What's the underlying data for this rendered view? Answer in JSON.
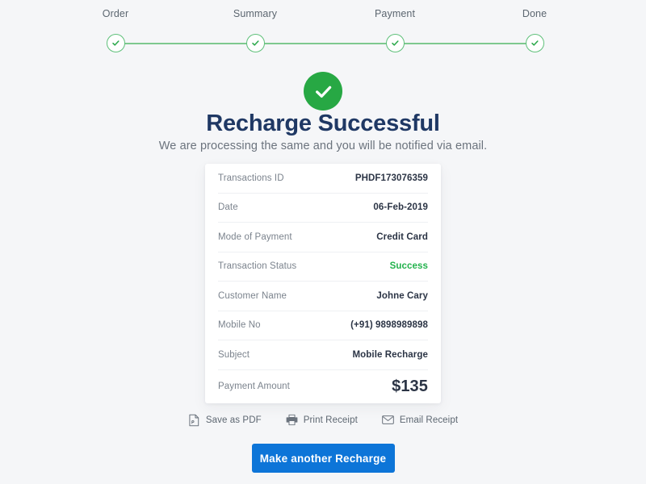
{
  "stepper": {
    "steps": [
      {
        "label": "Order",
        "state": "complete",
        "icon": "check-icon"
      },
      {
        "label": "Summary",
        "state": "complete",
        "icon": "check-icon"
      },
      {
        "label": "Payment",
        "state": "complete",
        "icon": "check-icon"
      },
      {
        "label": "Done",
        "state": "complete",
        "icon": "check-icon"
      }
    ],
    "line_color": "#7ec98f",
    "dot_border_color": "#5fc07a",
    "check_color": "#2aa84a"
  },
  "status": {
    "icon": "check-circle-icon",
    "icon_color": "#27a844",
    "headline": "Recharge Successful",
    "subhead": "We are processing the same and you will be notified via email."
  },
  "receipt": {
    "rows": [
      {
        "label": "Transactions ID",
        "value": "PHDF173076359"
      },
      {
        "label": "Date",
        "value": "06-Feb-2019"
      },
      {
        "label": "Mode of Payment",
        "value": "Credit Card"
      },
      {
        "label": "Transaction Status",
        "value": "Success"
      },
      {
        "label": "Customer Name",
        "value": "Johne Cary"
      },
      {
        "label": "Mobile No",
        "value": "(+91) 9898989898"
      },
      {
        "label": "Subject",
        "value": "Mobile Recharge"
      },
      {
        "label": "Payment Amount",
        "value": "$135"
      }
    ],
    "success_color": "#22b24c"
  },
  "actions": [
    {
      "label": "Save as PDF",
      "icon": "file-pdf-icon"
    },
    {
      "label": "Print Receipt",
      "icon": "printer-icon"
    },
    {
      "label": "Email Receipt",
      "icon": "envelope-icon"
    }
  ],
  "cta": {
    "label": "Make another Recharge",
    "color": "#0d75d8"
  }
}
